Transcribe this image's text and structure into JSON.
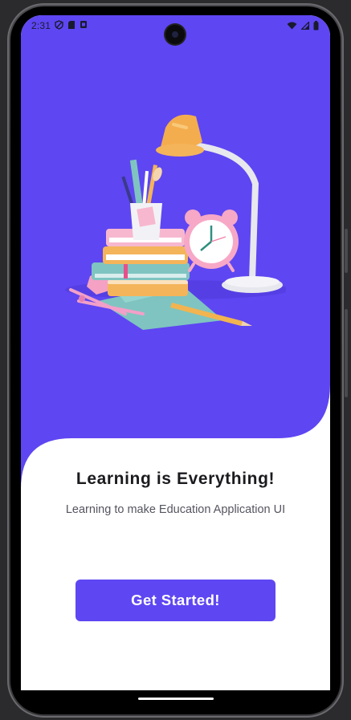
{
  "status_bar": {
    "time": "2:31",
    "left_icons": [
      "shield-icon",
      "sd-card-icon",
      "app-notification-icon"
    ],
    "right_icons": [
      "wifi-icon",
      "signal-icon",
      "battery-icon"
    ]
  },
  "onboarding": {
    "title": "Learning is Everything!",
    "subtitle": "Learning to make Education Application UI",
    "cta_label": "Get Started!"
  },
  "colors": {
    "accent": "#5e46f2",
    "background": "#ffffff",
    "title_text": "#1b1b1f",
    "subtitle_text": "#555560"
  }
}
